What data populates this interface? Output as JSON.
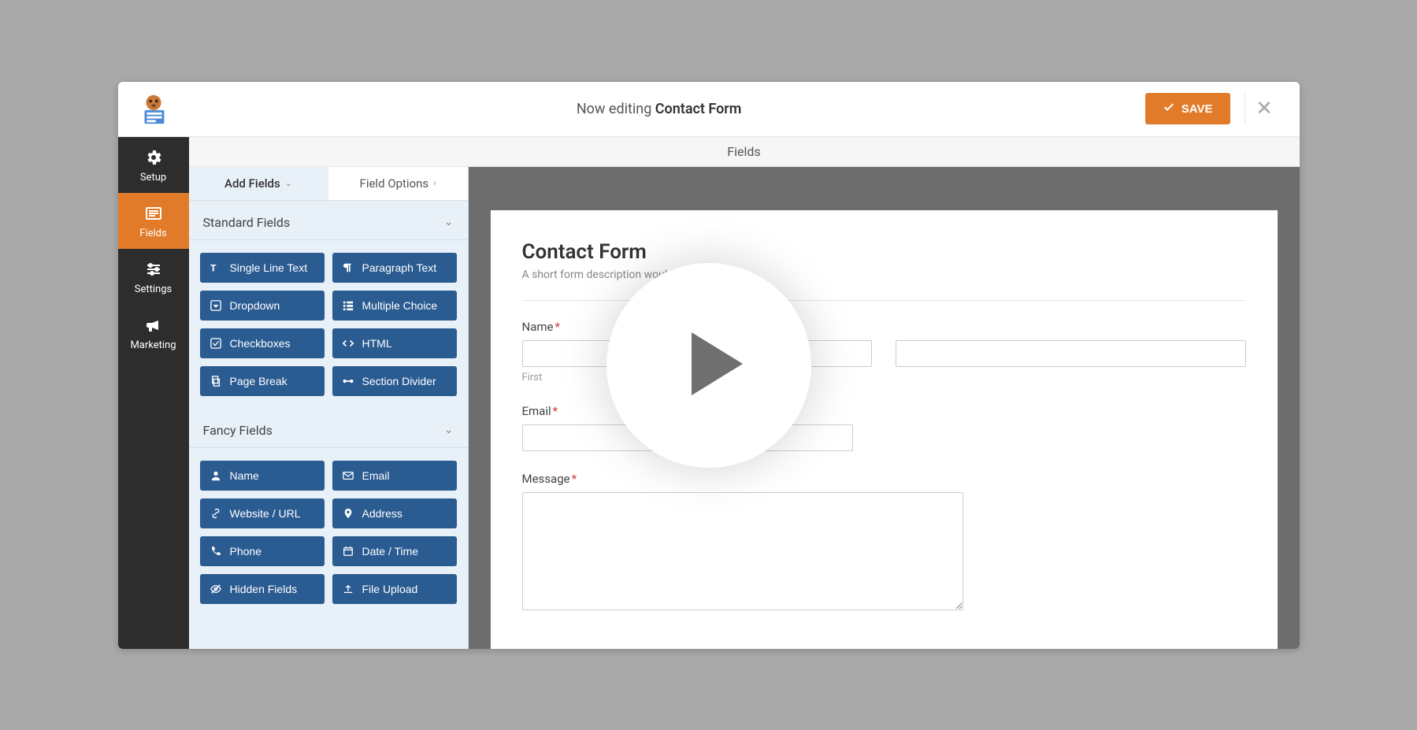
{
  "topbar": {
    "editing_prefix": "Now editing ",
    "form_name": "Contact Form",
    "save_label": "SAVE"
  },
  "subheader": {
    "title": "Fields"
  },
  "leftnav": {
    "setup": "Setup",
    "fields": "Fields",
    "settings": "Settings",
    "marketing": "Marketing"
  },
  "tabs": {
    "add_fields": "Add Fields",
    "field_options": "Field Options"
  },
  "groups": {
    "standard": {
      "title": "Standard Fields",
      "items": [
        {
          "label": "Single Line Text"
        },
        {
          "label": "Paragraph Text"
        },
        {
          "label": "Dropdown"
        },
        {
          "label": "Multiple Choice"
        },
        {
          "label": "Checkboxes"
        },
        {
          "label": "HTML"
        },
        {
          "label": "Page Break"
        },
        {
          "label": "Section Divider"
        }
      ]
    },
    "fancy": {
      "title": "Fancy Fields",
      "items": [
        {
          "label": "Name"
        },
        {
          "label": "Email"
        },
        {
          "label": "Website / URL"
        },
        {
          "label": "Address"
        },
        {
          "label": "Phone"
        },
        {
          "label": "Date / Time"
        },
        {
          "label": "Hidden Fields"
        },
        {
          "label": "File Upload"
        }
      ]
    }
  },
  "preview": {
    "title": "Contact Form",
    "description": "A short form description would go here.",
    "name_label": "Name",
    "first_sublabel": "First",
    "email_label": "Email",
    "message_label": "Message"
  }
}
